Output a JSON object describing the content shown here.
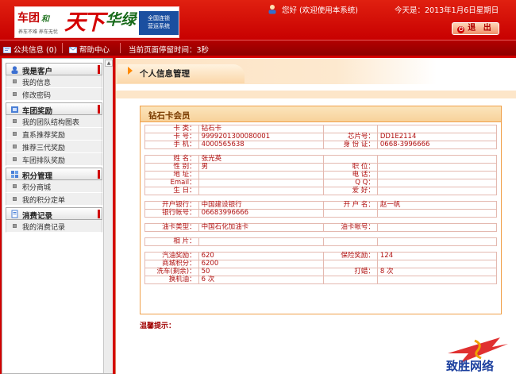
{
  "header": {
    "logo": {
      "brand1": "车团",
      "brand1_sub": "和",
      "big": "天下",
      "brand2": "华绿",
      "sys_line1": "全国连锁",
      "sys_line2": "营运系统",
      "slogan": "养车不难 养车无忧"
    },
    "welcome": "您好 (欢迎使用本系统)",
    "today": "今天是：2013年1月6日星期日",
    "logout_label": "退 出"
  },
  "topbar": {
    "notice": "公共信息 (0)",
    "help": "帮助中心",
    "stay_time": "当前页面停留时间：3秒"
  },
  "sidebar": {
    "groups": [
      {
        "label": "我是客户",
        "icon": "user-group-icon",
        "items": [
          "我的信息",
          "修改密码"
        ]
      },
      {
        "label": "车团奖励",
        "icon": "award-icon",
        "items": [
          "我的团队结构图表",
          "直系推荐奖励",
          "推荐三代奖励",
          "车团排队奖励"
        ]
      },
      {
        "label": "积分管理",
        "icon": "points-icon",
        "items": [
          "积分商城",
          "我的积分定单"
        ]
      },
      {
        "label": "消费记录",
        "icon": "record-icon",
        "items": [
          "我的消费记录"
        ]
      }
    ]
  },
  "main": {
    "title": "个人信息管理",
    "card_title": "钻石卡会员",
    "rows": [
      [
        "卡 类：",
        "钻石卡",
        "",
        ""
      ],
      [
        "卡 号：",
        "9999201300080001",
        "芯片号：",
        "DD1E2114"
      ],
      [
        "手 机：",
        "4000565638",
        "身 份 证：",
        "0668-3996666"
      ],
      [
        "",
        "",
        "",
        ""
      ],
      [
        "姓 名：",
        "张光英",
        "",
        ""
      ],
      [
        "性 别：",
        "男",
        "职 位：",
        ""
      ],
      [
        "地 址：",
        "",
        "电 话：",
        ""
      ],
      [
        "Email：",
        "",
        "Q Q：",
        ""
      ],
      [
        "生 日：",
        "",
        "爱 好：",
        ""
      ],
      [
        "",
        "",
        "",
        ""
      ],
      [
        "开户银行：",
        "中国建设银行",
        "开 户 名：",
        "赵一帆"
      ],
      [
        "银行帐号：",
        "06683996666",
        "",
        ""
      ],
      [
        "",
        "",
        "",
        ""
      ],
      [
        "油卡类型：",
        "中国石化加油卡",
        "油卡帐号：",
        ""
      ],
      [
        "",
        "",
        "",
        ""
      ],
      [
        "相 片：",
        "",
        "",
        ""
      ],
      [
        "",
        "",
        "",
        ""
      ],
      [
        "汽油奖励：",
        "620",
        "保险奖励：",
        "124"
      ],
      [
        "商城积分：",
        "6200",
        "",
        ""
      ],
      [
        "洗车(剩余)：",
        "50",
        "打蜡：",
        "8 次"
      ],
      [
        "换机油：",
        "6 次",
        "",
        ""
      ]
    ],
    "tip_label": "温馨提示："
  },
  "watermark": {
    "text": "致胜网络"
  }
}
